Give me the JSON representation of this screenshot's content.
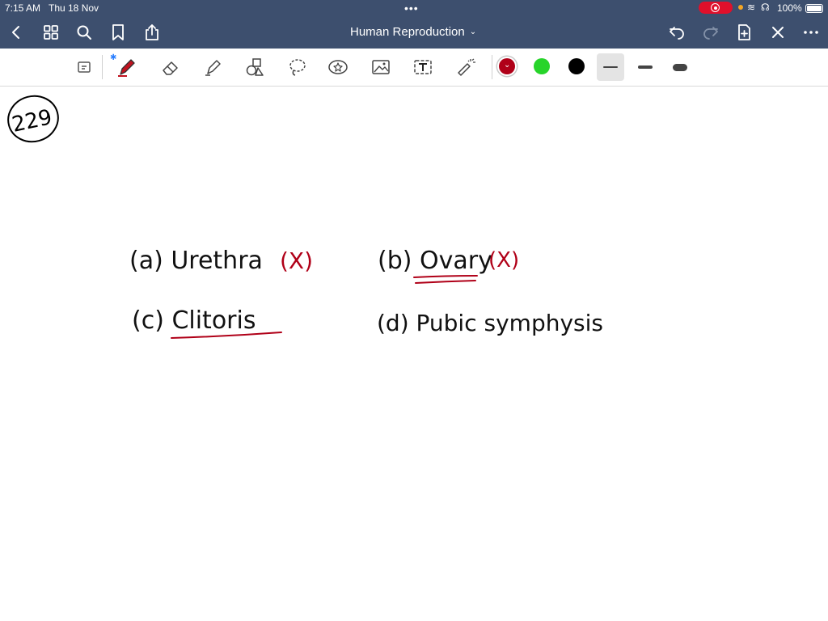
{
  "status_bar": {
    "time": "7:15 AM",
    "date": "Thu 18 Nov",
    "battery": "100%"
  },
  "document": {
    "title": "Human Reproduction"
  },
  "toolbar": {
    "colors": [
      "#b00018",
      "#27d42a",
      "#000000"
    ],
    "icons": [
      "select-icon",
      "pen-icon",
      "eraser-icon",
      "highlighter-icon",
      "shapes-icon",
      "lasso-icon",
      "sticker-icon",
      "image-icon",
      "text-icon",
      "laser-pointer-icon"
    ]
  },
  "notes": {
    "question_number": "229",
    "option_a": "(a) Urethra",
    "option_a_mark": "(X)",
    "option_b": "(b) Ovary",
    "option_b_mark": "(X)",
    "option_c": "(c) Clitoris",
    "option_d": "(d) Pubic symphysis"
  }
}
